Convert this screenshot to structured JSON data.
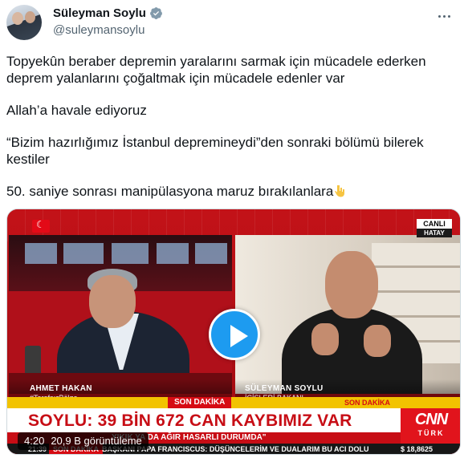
{
  "author": {
    "name": "Süleyman Soylu",
    "handle": "@suleymansoylu"
  },
  "tweet": {
    "lines": [
      "Topyekûn beraber depremin yaralarını sarmak için mücadele ederken\ndeprem yalanlarını çoğaltmak için mücadele edenler var",
      "Allah’a havale ediyoruz",
      "“Bizim hazırlığımız İstanbul depremineydi”den sonraki bölümü bilerek\nkestiler",
      "50. saniye sonrası manipülasyona maruz bırakılanlara"
    ],
    "emoji": "pointing-down-emoji"
  },
  "video": {
    "canli_top": "CANLI",
    "canli_location": "HATAY",
    "left_name": "AHMET HAKAN",
    "left_sub": "#TarafsızBölge",
    "right_name": "SÜLEYMAN SOYLU",
    "right_sub": "İÇİŞLERİ BAKANI",
    "son_dakika": "SON DAKİKA",
    "son_dakika_right": "SON DAKİKA",
    "headline": "SOYLU: 39 BİN 672 CAN KAYBIMIZ VAR",
    "subline": "YIKIK YA DA AĞIR HASARLI DURUMDA\"",
    "cnn_logo": "CNN",
    "cnn_turk": "TÜRK",
    "ticker_time": "21:39",
    "ticker_tag": "SON DAKİKA",
    "ticker_text": "BAŞKANI PAPA FRANCISCUS: DÜŞÜNCELERİM VE DUALARIM BU ACI DOLU",
    "ticker_currency": "$ 18,8625",
    "duration": "4:20",
    "views": "20,9 B görüntüleme"
  },
  "colors": {
    "accent": "#1d9bf0",
    "text_secondary": "#536471",
    "cnn_red": "#c70d15"
  },
  "icons": [
    "verified-badge-icon",
    "more-options-icon",
    "play-icon",
    "flag-icon"
  ]
}
